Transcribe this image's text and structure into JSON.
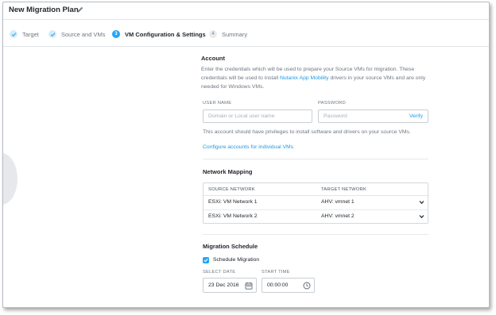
{
  "header": {
    "title": "New Migration Plan",
    "edit_icon": "pencil-icon"
  },
  "steps": [
    {
      "number": "1",
      "label": "Target",
      "state": "done"
    },
    {
      "number": "2",
      "label": "Source and VMs",
      "state": "done"
    },
    {
      "number": "3",
      "label": "VM Configuration & Settings",
      "state": "active"
    },
    {
      "number": "4",
      "label": "Summary",
      "state": "pending"
    }
  ],
  "account": {
    "title": "Account",
    "desc_prefix": "Enter the credentials which will be used to prepare your Source VMs for migration. These credentials will be used to install ",
    "desc_link": "Nutanix App Mobility",
    "desc_suffix": " drivers in your source VMs and are only needed for Windows VMs.",
    "username_label": "USER NAME",
    "username_placeholder": "Domain or Local user name",
    "password_label": "PASSWORD",
    "password_placeholder": "Password",
    "verify_label": "Verify",
    "hint": "This account should have privileges to install software and drivers on your source VMs.",
    "configure_link": "Configure accounts for individual VMs"
  },
  "network_mapping": {
    "title": "Network Mapping",
    "columns": [
      "SOURCE NETWORK",
      "TARGET NETWORK"
    ],
    "rows": [
      {
        "source": "ESXi: VM Network 1",
        "target": "AHV: vmnet 1"
      },
      {
        "source": "ESXi: VM Network 2",
        "target": "AHV: vmnet 2"
      }
    ]
  },
  "schedule": {
    "title": "Migration Schedule",
    "checkbox_label": "Schedule Migration",
    "checked": true,
    "date_label": "SELECT DATE",
    "date_value": "23 Dec 2016",
    "time_label": "START TIME",
    "time_value": "00:00:00"
  },
  "colors": {
    "accent": "#22a5f7",
    "link": "#1b9ae8"
  }
}
